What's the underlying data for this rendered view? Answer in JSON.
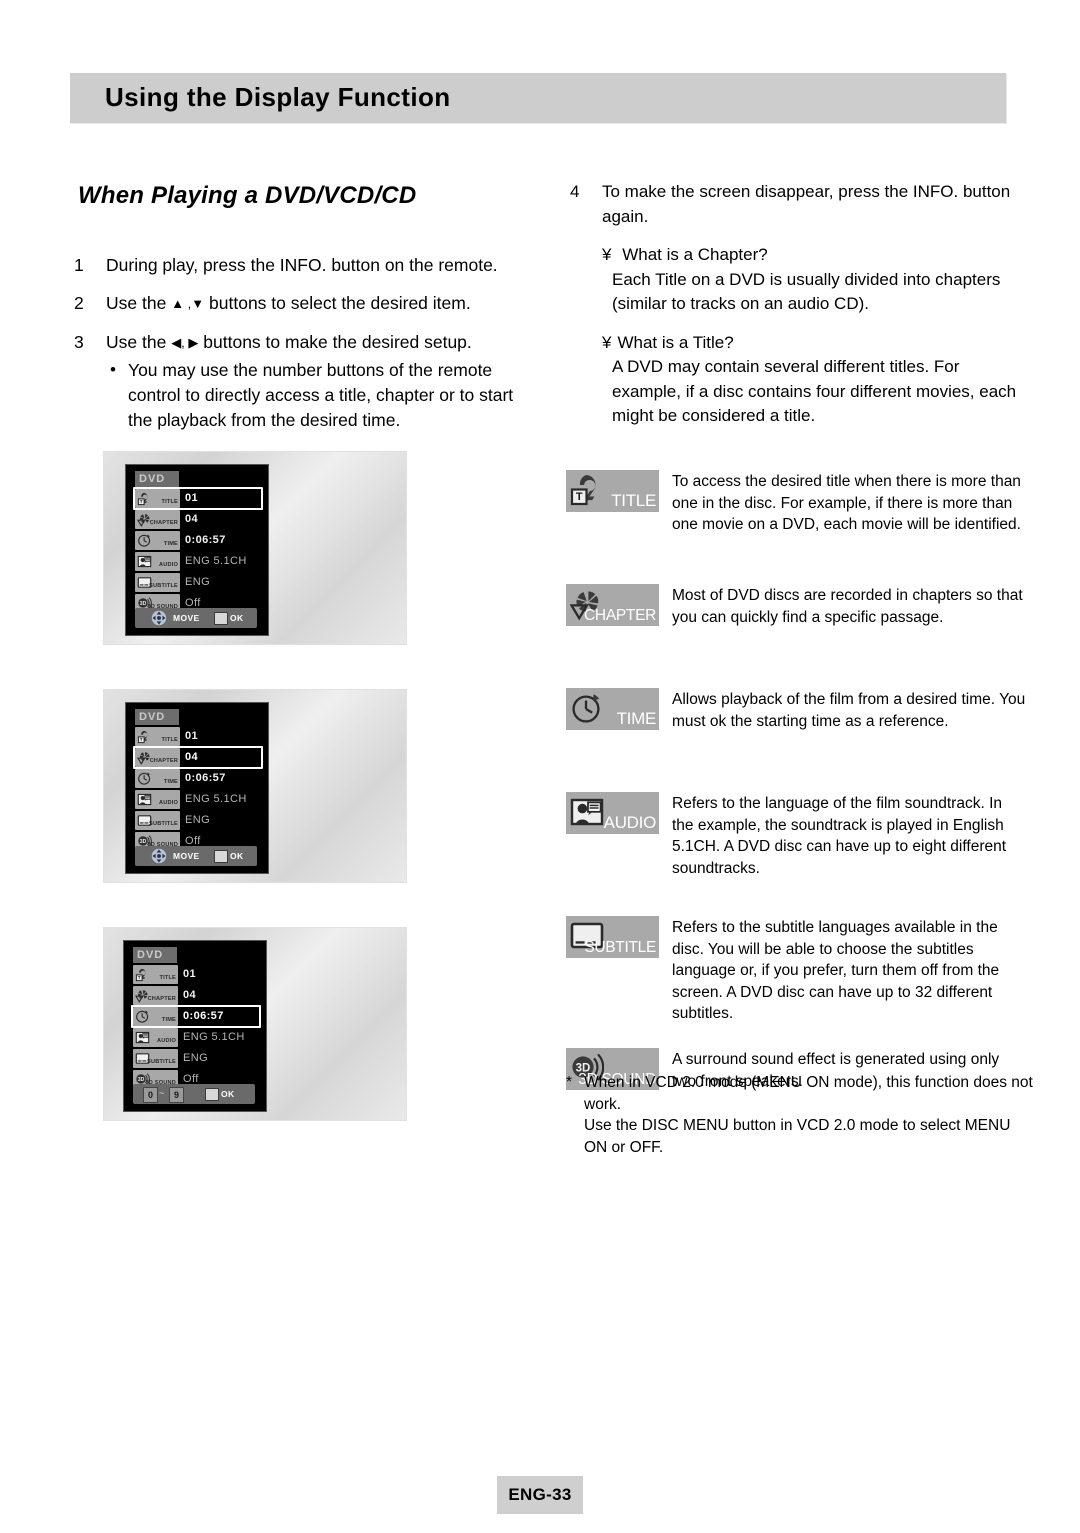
{
  "header": {
    "title": "Using the Display Function"
  },
  "section": {
    "heading": "When Playing a DVD/VCD/CD"
  },
  "left_steps": [
    {
      "num": "1",
      "text_before": "During play, press the INFO. button on the remote.",
      "text_after": ""
    },
    {
      "num": "2",
      "text_before": "Use the ",
      "arrows": "▲ ,▼",
      "text_after": " buttons to select the desired item."
    },
    {
      "num": "3",
      "text_before": "Use the ",
      "arrows": "◀, ▶",
      "text_after": " buttons to make the desired setup."
    }
  ],
  "left_bullet": {
    "dot": "•",
    "text": "You may use the number buttons of the remote control to directly access a title, chapter or to start the playback from the desired time."
  },
  "right_step": {
    "num": "4",
    "text": "To make the screen disappear, press the INFO. button again."
  },
  "qa": [
    {
      "yen": "¥",
      "question": " What is a Chapter?",
      "answer": "Each Title on a DVD is usually divided into chapters (similar to  tracks on an audio CD)."
    },
    {
      "yen": "¥",
      "question": "What is a Title?",
      "answer": "A DVD may contain several different titles. For example, if a disc contains four different movies, each might be considered a title."
    }
  ],
  "osd_screens": [
    {
      "disc_label": "DVD",
      "selected": "TITLE",
      "rows": [
        {
          "icon": "title-icon",
          "chip_label": "TITLE",
          "value": "01"
        },
        {
          "icon": "chapter-icon",
          "chip_label": "CHAPTER",
          "value": "04"
        },
        {
          "icon": "time-icon",
          "chip_label": "TIME",
          "value": "0:06:57"
        },
        {
          "icon": "audio-icon",
          "chip_label": "AUDIO",
          "value": "ENG 5.1CH"
        },
        {
          "icon": "subtitle-icon",
          "chip_label": "SUBTITLE",
          "value": "ENG"
        },
        {
          "icon": "3d-sound-icon",
          "chip_label": "3D SOUND",
          "value": "Off"
        }
      ],
      "bottom": {
        "type": "move",
        "move_label": "MOVE",
        "ok_label": "OK"
      }
    },
    {
      "disc_label": "DVD",
      "selected": "CHAPTER",
      "rows": [
        {
          "icon": "title-icon",
          "chip_label": "TITLE",
          "value": "01"
        },
        {
          "icon": "chapter-icon",
          "chip_label": "CHAPTER",
          "value": "04"
        },
        {
          "icon": "time-icon",
          "chip_label": "TIME",
          "value": "0:06:57"
        },
        {
          "icon": "audio-icon",
          "chip_label": "AUDIO",
          "value": "ENG 5.1CH"
        },
        {
          "icon": "subtitle-icon",
          "chip_label": "SUBTITLE",
          "value": "ENG"
        },
        {
          "icon": "3d-sound-icon",
          "chip_label": "3D SOUND",
          "value": "Off"
        }
      ],
      "bottom": {
        "type": "move",
        "move_label": "MOVE",
        "ok_label": "OK"
      }
    },
    {
      "disc_label": "DVD",
      "selected": "TIME",
      "rows": [
        {
          "icon": "title-icon",
          "chip_label": "TITLE",
          "value": "01"
        },
        {
          "icon": "chapter-icon",
          "chip_label": "CHAPTER",
          "value": "04"
        },
        {
          "icon": "time-icon",
          "chip_label": "TIME",
          "value": "0:06:57"
        },
        {
          "icon": "audio-icon",
          "chip_label": "AUDIO",
          "value": "ENG 5.1CH"
        },
        {
          "icon": "subtitle-icon",
          "chip_label": "SUBTITLE",
          "value": "ENG"
        },
        {
          "icon": "3d-sound-icon",
          "chip_label": "3D SOUND",
          "value": "Off"
        }
      ],
      "bottom": {
        "type": "numeric",
        "num_from": "0",
        "tilde": "~",
        "num_to": "9",
        "ok_label": "OK"
      }
    }
  ],
  "icon_descriptions": [
    {
      "icon": "title-icon",
      "label": "TITLE",
      "desc": "To access the desired title when there is more than one in the disc. For example, if there is more than one movie on a DVD, each movie will be identified."
    },
    {
      "icon": "chapter-icon",
      "label": "CHAPTER",
      "desc": "Most of DVD discs are recorded in chapters so that you can quickly find a specific passage."
    },
    {
      "icon": "time-icon",
      "label": "TIME",
      "desc": "Allows playback of the film from a desired time. You must ok the starting time as a reference."
    },
    {
      "icon": "audio-icon",
      "label": "AUDIO",
      "desc": "Refers to the language of the film soundtrack. In the example, the soundtrack is played in English 5.1CH. A DVD disc can have up to eight different soundtracks."
    },
    {
      "icon": "subtitle-icon",
      "label": "SUBTITLE",
      "desc": "Refers to the subtitle languages available in the disc. You will be able to choose the subtitles language or, if you prefer, turn them off from the screen. A DVD disc can have up to 32 different subtitles."
    },
    {
      "icon": "3d-sound-icon",
      "label": "3D SOUND",
      "desc": "A surround sound effect is generated using only two front speakers."
    }
  ],
  "footnote": {
    "star": "*",
    "line1": "When in VCD 2.0 mode (MENU ON mode), this function does not work.",
    "line2": "Use the DISC MENU button in VCD 2.0 mode to select MENU ON or OFF."
  },
  "footer": {
    "page_label": "ENG-33"
  },
  "colors": {
    "header_bg": "#cdcdcd",
    "badge_bg": "#a9a9a9",
    "osd_bg": "#000000",
    "chip_bg": "#a8a8a8",
    "footer_bg": "#cfcfcf"
  }
}
